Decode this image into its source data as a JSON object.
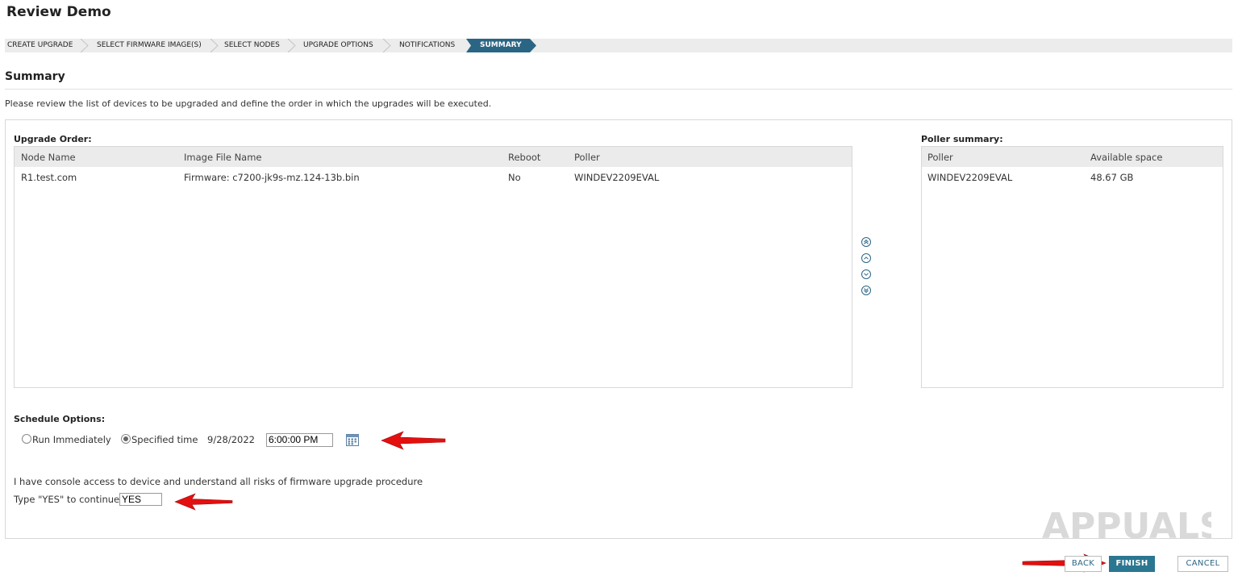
{
  "page_title": "Review Demo",
  "wizard_steps": [
    {
      "label": "CREATE UPGRADE",
      "active": false
    },
    {
      "label": "SELECT FIRMWARE IMAGE(S)",
      "active": false
    },
    {
      "label": "SELECT NODES",
      "active": false
    },
    {
      "label": "UPGRADE OPTIONS",
      "active": false
    },
    {
      "label": "NOTIFICATIONS",
      "active": false
    },
    {
      "label": "SUMMARY",
      "active": true
    }
  ],
  "summary": {
    "title": "Summary",
    "intro": "Please review the list of devices to be upgraded and define the order in which the upgrades will be executed."
  },
  "upgrade_order": {
    "label": "Upgrade Order:",
    "columns": [
      "Node Name",
      "Image File Name",
      "Reboot",
      "Poller"
    ],
    "rows": [
      [
        "R1.test.com",
        "Firmware: c7200-jk9s-mz.124-13b.bin",
        "No",
        "WINDEV2209EVAL"
      ]
    ]
  },
  "reorder_controls": [
    "move-top-icon",
    "move-up-icon",
    "move-down-icon",
    "move-bottom-icon"
  ],
  "poller_summary": {
    "label": "Poller summary:",
    "columns": [
      "Poller",
      "Available space"
    ],
    "rows": [
      [
        "WINDEV2209EVAL",
        "48.67 GB"
      ]
    ]
  },
  "schedule": {
    "label": "Schedule Options:",
    "run_immediately": "Run Immediately",
    "specified_time": "Specified time",
    "selected": "specified_time",
    "date": "9/28/2022",
    "time": "6:00:00 PM",
    "calendar_icon": "calendar-icon"
  },
  "consent": {
    "statement": "I have console access to device and understand all risks of firmware upgrade procedure",
    "prompt": "Type \"YES\" to continue:",
    "value": "YES"
  },
  "buttons": {
    "back": "BACK",
    "finish": "FINISH",
    "cancel": "CANCEL"
  },
  "watermark": "APPUALS",
  "colors": {
    "accent": "#2b6584",
    "finish": "#2b7691",
    "annotation_arrow": "#e3100f"
  }
}
